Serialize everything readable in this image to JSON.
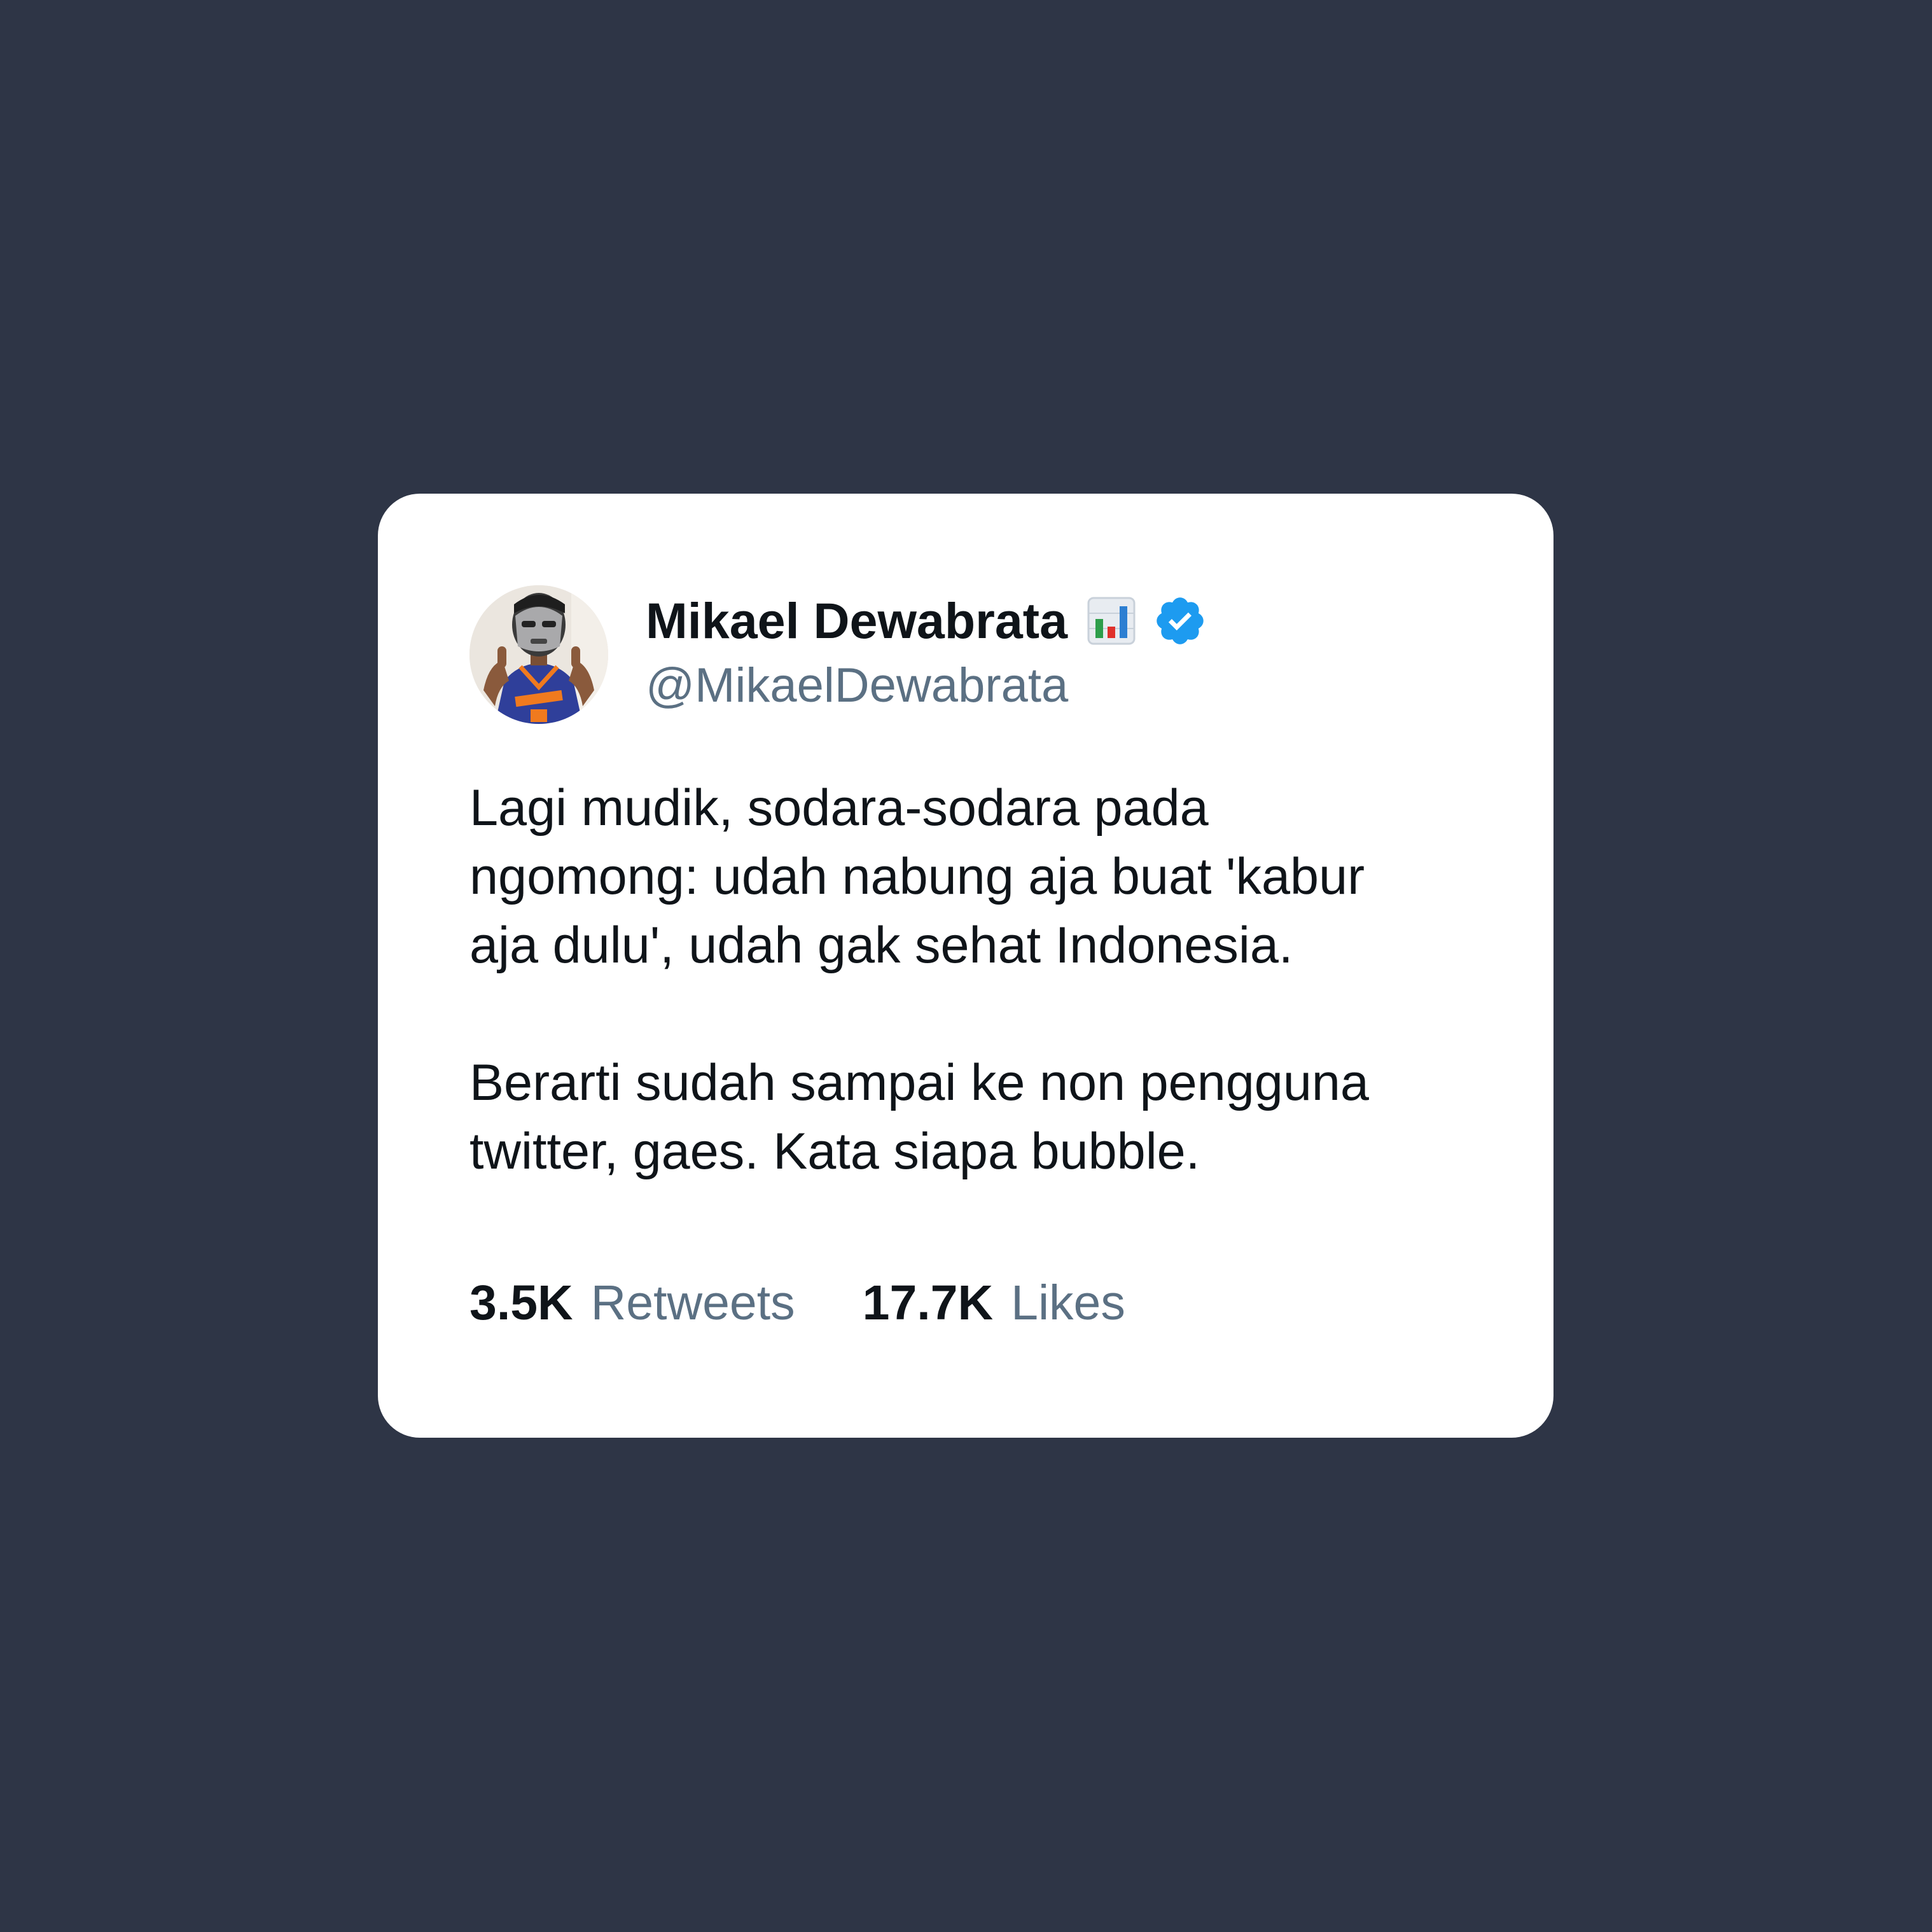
{
  "tweet": {
    "author": {
      "display_name": "Mikael Dewabrata",
      "name_emoji": "bar-chart-emoji",
      "verified_icon": "verified-badge-icon",
      "handle": "@MikaelDewabrata",
      "avatar": "profile-photo"
    },
    "text_lines": [
      "Lagi mudik, sodara-sodara pada",
      "ngomong: udah nabung aja buat 'kabur",
      "aja dulu', udah gak sehat Indonesia.",
      "Berarti sudah sampai ke non pengguna",
      "twitter, gaes. Kata siapa bubble."
    ],
    "stats": {
      "retweets_count": "3.5K",
      "retweets_label": "Retweets",
      "likes_count": "17.7K",
      "likes_label": "Likes"
    }
  },
  "colors": {
    "background": "#2e3546",
    "card": "#ffffff",
    "text_primary": "#0f1419",
    "text_secondary": "#5b7083",
    "verified_blue": "#1d9bf0"
  }
}
